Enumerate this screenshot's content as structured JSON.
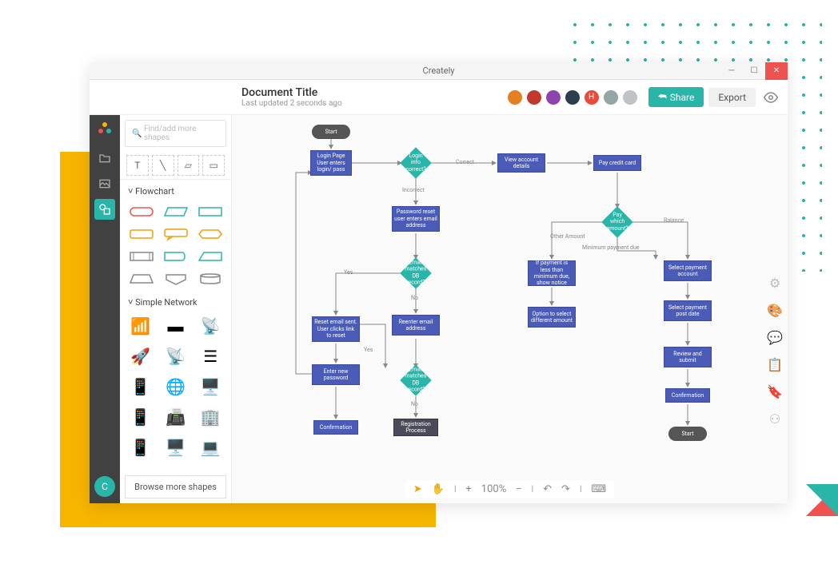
{
  "app_title": "Creately",
  "doc": {
    "title": "Document Title",
    "subtitle": "Last updated 2 seconds ago"
  },
  "toolbar": {
    "share": "Share",
    "export": "Export"
  },
  "search": {
    "placeholder": "Find/add more shapes"
  },
  "sections": {
    "flowchart": "˅ Flowchart",
    "network": "˅ Simple Network"
  },
  "browse_more": "Browse more shapes",
  "zoom": "100%",
  "rail_user": "C",
  "avatars": [
    {
      "bg": "#e67e22"
    },
    {
      "bg": "#c0392b"
    },
    {
      "bg": "#8e44ad"
    },
    {
      "bg": "#2c3e50"
    },
    {
      "bg": "#e74c3c",
      "txt": "H"
    },
    {
      "bg": "#95a5a6"
    },
    {
      "bg": "#bdc3c7"
    }
  ],
  "flow": {
    "start": "Start",
    "login": "Login Page User enters login/ pass",
    "login_correct": "Login info correct?",
    "correct": "Correct",
    "incorrect": "Incorrect",
    "view_account": "View account details",
    "pay_card": "Pay credit card",
    "pwd_reset": "Password reset user enters email address",
    "email_match": "Email matches DB record?",
    "yes": "Yes",
    "no": "No",
    "reset_sent": "Reset email sent. User clicks link to reset",
    "reenter": "Reenter email address",
    "enter_new": "Enter new password",
    "email_match2": "Email matches DB record?",
    "confirmation": "Confirmation",
    "registration": "Registration Process",
    "pay_which": "Pay which amount?",
    "other_amt": "Other Amount",
    "balance": "Balance",
    "min_due": "Minimum payment due",
    "if_less": "If payment is less than minimum due, show notice",
    "opt_diff": "Option to select different amount",
    "sel_acct": "Select payment account",
    "sel_date": "Select payment post date",
    "review": "Review and submit",
    "conf2": "Confirmation",
    "start2": "Start"
  }
}
